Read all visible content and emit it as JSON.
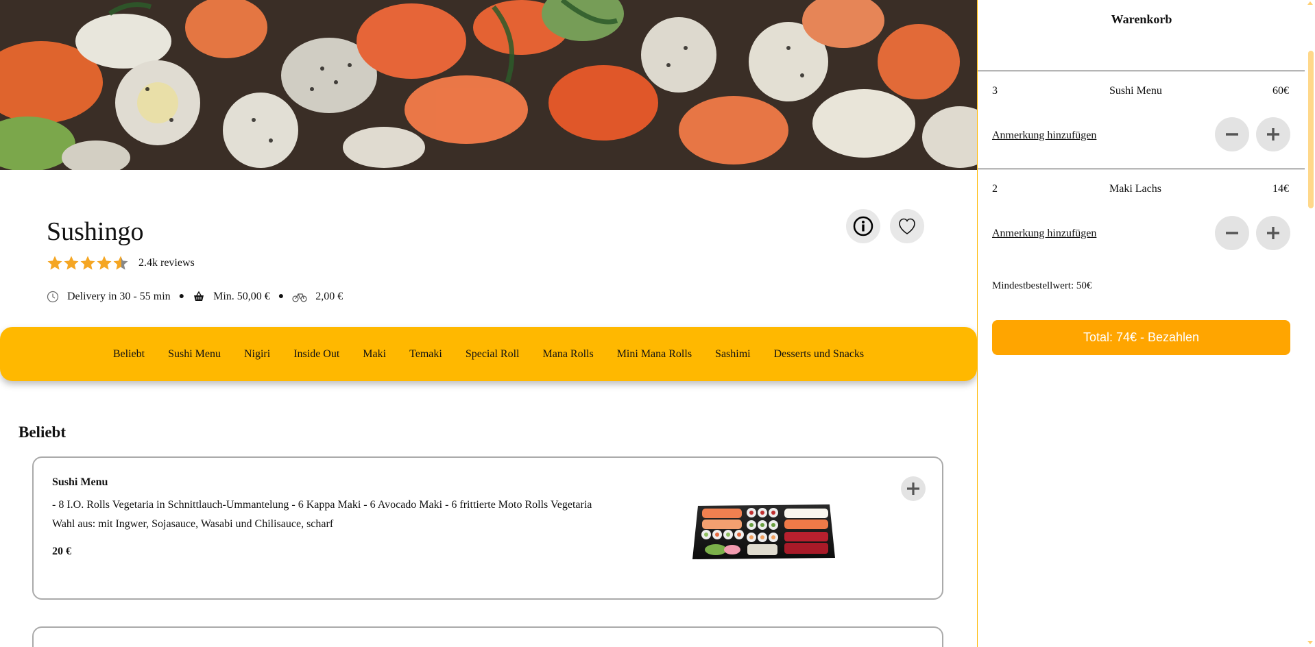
{
  "restaurant": {
    "name": "Sushingo",
    "rating": 4.6,
    "reviews": "2.4k reviews",
    "delivery_time": "Delivery in 30 - 55 min",
    "min_order": "Min. 50,00 €",
    "delivery_fee": "2,00 €"
  },
  "icons": {
    "info": "info-icon",
    "favorite": "heart-icon",
    "clock": "clock-icon",
    "basket": "basket-icon",
    "bike": "bike-icon",
    "plus": "plus-icon",
    "minus": "minus-icon"
  },
  "categories": [
    "Beliebt",
    "Sushi Menu",
    "Nigiri",
    "Inside Out",
    "Maki",
    "Temaki",
    "Special Roll",
    "Mana Rolls",
    "Mini Mana Rolls",
    "Sashimi",
    "Desserts und Snacks"
  ],
  "section": {
    "title": "Beliebt"
  },
  "products": [
    {
      "name": "Sushi Menu",
      "description": "- 8 I.O. Rolls Vegetaria in Schnittlauch-Ummantelung - 6 Kappa Maki - 6 Avocado Maki - 6 frittierte Moto Rolls Vegetaria",
      "options": "Wahl aus: mit Ingwer, Sojasauce, Wasabi und Chilisauce, scharf",
      "price": "20 €"
    }
  ],
  "cart": {
    "title": "Warenkorb",
    "items": [
      {
        "qty": "3",
        "name": "Sushi Menu",
        "price": "60€",
        "note_label": "Anmerkung hinzufügen"
      },
      {
        "qty": "2",
        "name": "Maki Lachs",
        "price": "14€",
        "note_label": "Anmerkung hinzufügen"
      }
    ],
    "min_order_text": "Mindestbestellwert: 50€",
    "checkout_label": "Total: 74€ - Bezahlen"
  },
  "colors": {
    "accent": "#ffb800",
    "checkout": "#ffa500",
    "star": "#f5a623",
    "button_bg": "#e3e3e3"
  }
}
